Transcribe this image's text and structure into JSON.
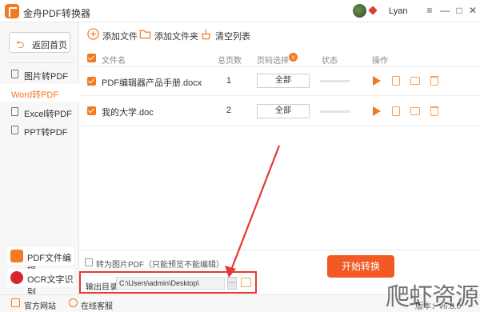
{
  "app": {
    "title": "金舟PDF转换器",
    "username": "Lyan"
  },
  "window_controls": {
    "menu": "≡",
    "minimize": "—",
    "maximize": "□",
    "close": "✕"
  },
  "sidebar": {
    "home_label": "返回首页",
    "items": [
      {
        "label": "图片转PDF",
        "active": false
      },
      {
        "label": "Word转PDF",
        "active": true
      },
      {
        "label": "Excel转PDF",
        "active": false
      },
      {
        "label": "PPT转PDF",
        "active": false
      }
    ],
    "tools": [
      {
        "label": "PDF文件编辑",
        "icon": "pdf-edit-icon",
        "color": "#f27a23"
      },
      {
        "label": "OCR文字识别",
        "icon": "ocr-eye-icon",
        "color": "#d9232d"
      }
    ]
  },
  "toolbar": {
    "add_file": "添加文件",
    "add_folder": "添加文件夹",
    "clear_list": "清空列表"
  },
  "table": {
    "headers": {
      "filename": "文件名",
      "pages": "总页数",
      "range": "页码选择",
      "status": "状态",
      "action": "操作"
    },
    "rows": [
      {
        "filename": "PDF编辑器产品手册.docx",
        "pages": "1",
        "range": "全部"
      },
      {
        "filename": "我的大学.doc",
        "pages": "2",
        "range": "全部"
      }
    ]
  },
  "bottom": {
    "image_pdf_label": "转为图片PDF（只能预览不能编辑）",
    "output_label": "输出目录：",
    "output_path": "C:\\Users\\admin\\Desktop\\",
    "browse": "···",
    "start_button": "开始转换"
  },
  "footer": {
    "website": "官方网站",
    "service": "在线客服",
    "version": "版本：v6.8.0"
  },
  "watermark": "爬虾资源",
  "colors": {
    "accent": "#f27a23",
    "start_button": "#f15a24",
    "annotation_red": "#e53935"
  }
}
